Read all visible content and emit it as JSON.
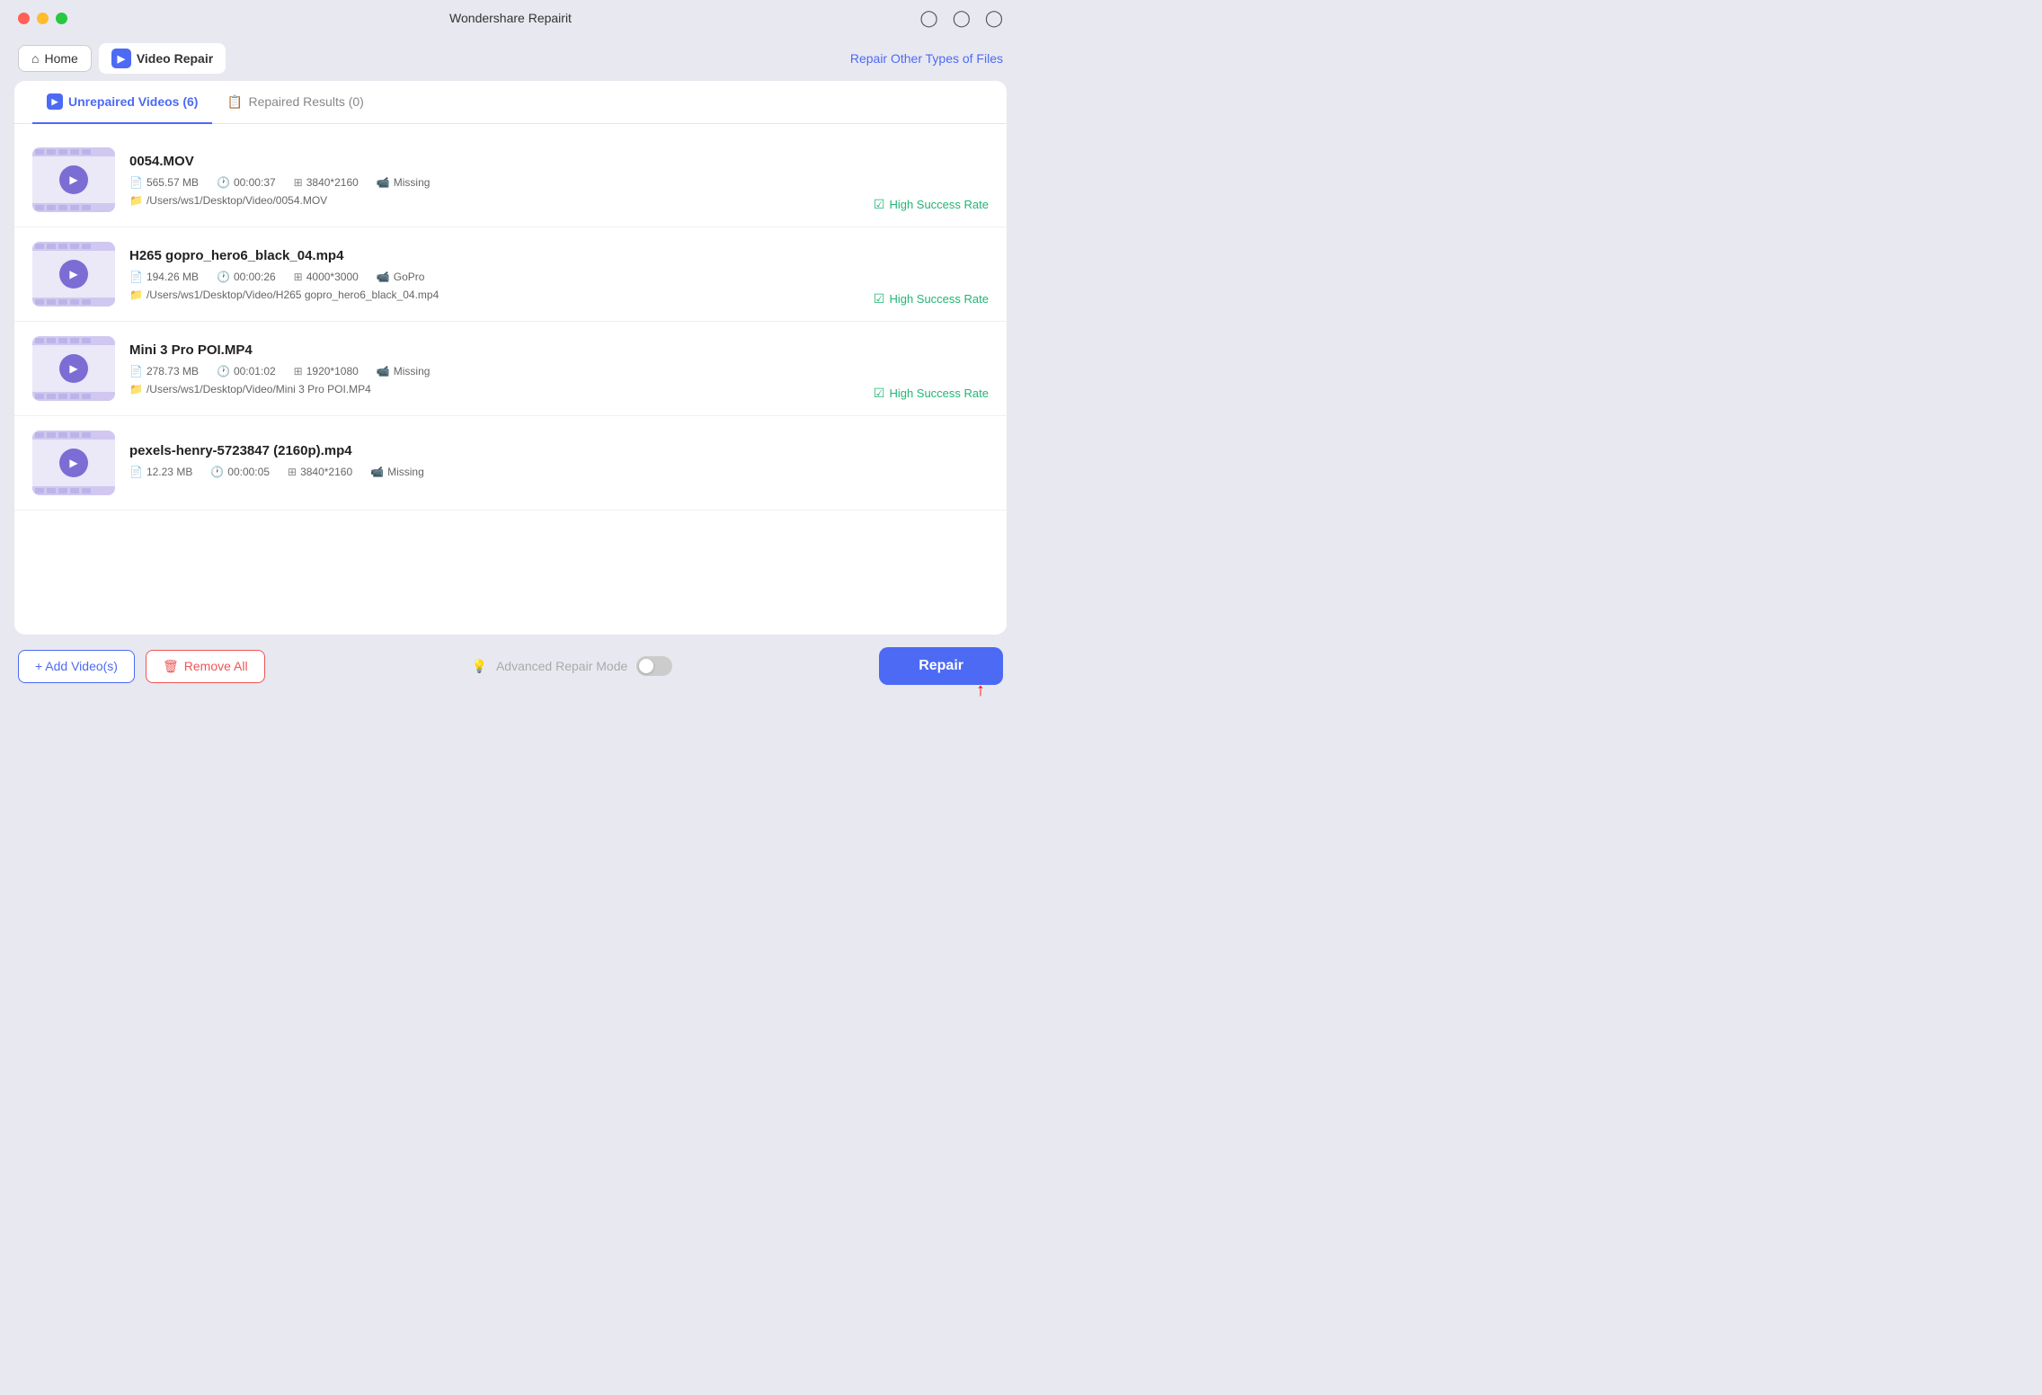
{
  "app": {
    "title": "Wondershare Repairit"
  },
  "titlebar": {
    "icons": [
      "person",
      "chat",
      "headset"
    ]
  },
  "nav": {
    "home_label": "Home",
    "video_repair_label": "Video Repair",
    "repair_other_label": "Repair Other Types of Files"
  },
  "tabs": [
    {
      "id": "unrepaired",
      "label": "Unrepaired Videos (6)",
      "active": true
    },
    {
      "id": "repaired",
      "label": "Repaired Results (0)",
      "active": false
    }
  ],
  "videos": [
    {
      "name": "0054.MOV",
      "size": "565.57 MB",
      "duration": "00:00:37",
      "resolution": "3840*2160",
      "camera": "Missing",
      "path": "/Users/ws1/Desktop/Video/0054.MOV",
      "success_rate": "High Success Rate"
    },
    {
      "name": "H265 gopro_hero6_black_04.mp4",
      "size": "194.26 MB",
      "duration": "00:00:26",
      "resolution": "4000*3000",
      "camera": "GoPro",
      "path": "/Users/ws1/Desktop/Video/H265 gopro_hero6_black_04.mp4",
      "success_rate": "High Success Rate"
    },
    {
      "name": "Mini 3 Pro POI.MP4",
      "size": "278.73 MB",
      "duration": "00:01:02",
      "resolution": "1920*1080",
      "camera": "Missing",
      "path": "/Users/ws1/Desktop/Video/Mini 3 Pro POI.MP4",
      "success_rate": "High Success Rate"
    },
    {
      "name": "pexels-henry-5723847 (2160p).mp4",
      "size": "12.23 MB",
      "duration": "00:00:05",
      "resolution": "3840*2160",
      "camera": "Missing",
      "path": "",
      "success_rate": ""
    }
  ],
  "bottom": {
    "add_label": "+ Add Video(s)",
    "remove_label": "Remove All",
    "advanced_mode_label": "Advanced Repair Mode",
    "repair_label": "Repair"
  }
}
